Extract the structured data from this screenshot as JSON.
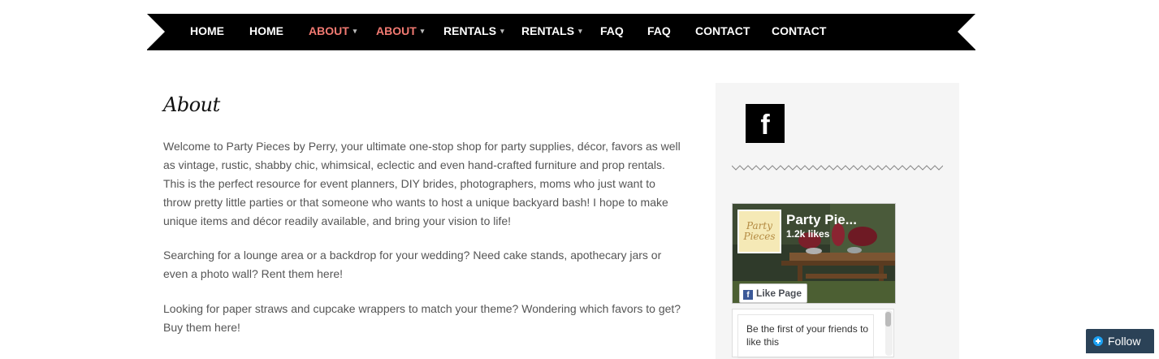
{
  "nav": {
    "items": [
      {
        "label": "HOME",
        "dropdown": false,
        "active": false
      },
      {
        "label": "HOME",
        "dropdown": false,
        "active": false
      },
      {
        "label": "ABOUT",
        "dropdown": true,
        "active": true
      },
      {
        "label": "ABOUT",
        "dropdown": true,
        "active": true
      },
      {
        "label": "RENTALS",
        "dropdown": true,
        "active": false
      },
      {
        "label": "RENTALS",
        "dropdown": true,
        "active": false
      },
      {
        "label": "FAQ",
        "dropdown": false,
        "active": false
      },
      {
        "label": "FAQ",
        "dropdown": false,
        "active": false
      },
      {
        "label": "CONTACT",
        "dropdown": false,
        "active": false
      },
      {
        "label": "CONTACT",
        "dropdown": false,
        "active": false
      }
    ],
    "dropdown_glyph": "▾",
    "active_color": "#f27a72"
  },
  "main": {
    "title": "About",
    "paragraphs": [
      "Welcome to Party Pieces by Perry, your ultimate one-stop shop for party supplies, décor, favors as well as vintage, rustic, shabby chic, whimsical, eclectic and even hand-crafted furniture and prop rentals. This is the perfect resource for event planners, DIY brides, photographers, moms who just want to throw pretty little parties or that someone who wants to host a unique backyard bash! I hope to make unique items and décor readily available, and bring your vision to life!",
      "Searching for a lounge area or a backdrop for your wedding? Need cake stands, apothecary jars or even a photo wall? Rent them here!",
      "Looking for paper straws and cupcake wrappers to match your theme? Wondering which favors to get? Buy them here!"
    ]
  },
  "sidebar": {
    "social_icon": "facebook-icon",
    "social_glyph": "f",
    "fb_widget": {
      "page_name": "Party Pie...",
      "likes": "1.2k likes",
      "logo_text": "Party Pieces",
      "like_button": "Like Page",
      "friends_text": "Be the first of your friends to like this"
    }
  },
  "follow": {
    "label": "Follow",
    "icon": "plus-circle-icon"
  }
}
